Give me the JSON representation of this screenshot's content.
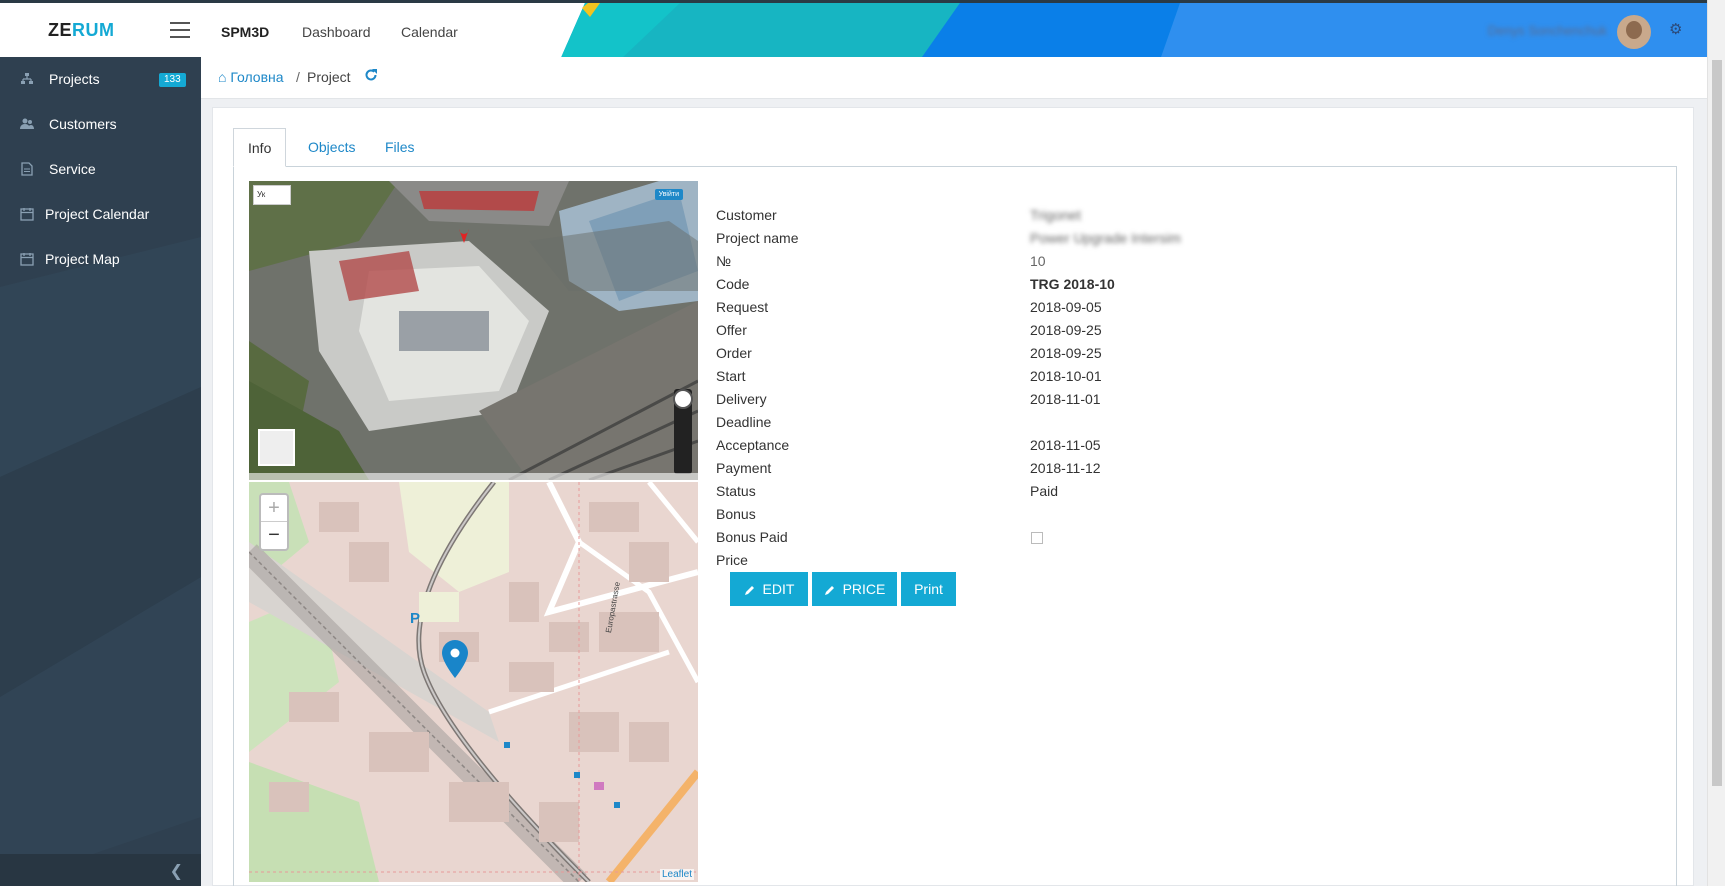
{
  "header": {
    "logo_a": "ZE",
    "logo_b": "RUM",
    "brand": "SPM3D",
    "nav": [
      "Dashboard",
      "Calendar"
    ],
    "user_name": "Denys Sonchenchuk"
  },
  "sidebar": {
    "items": [
      {
        "label": "Projects",
        "icon": "sitemap-icon",
        "badge": "133"
      },
      {
        "label": "Customers",
        "icon": "users-icon"
      },
      {
        "label": "Service",
        "icon": "file-icon"
      },
      {
        "label": "Project Calendar",
        "icon": "calendar-icon"
      },
      {
        "label": "Project Map",
        "icon": "calendar-icon"
      }
    ]
  },
  "breadcrumb": {
    "home": "Головна",
    "separator": "/",
    "current": "Project"
  },
  "tabs": [
    "Info",
    "Objects",
    "Files"
  ],
  "maps": {
    "streetview_lang": "Ук",
    "streetview_exit": "Увійти",
    "leaflet_attribution": "Leaflet",
    "parking_label": "P",
    "street_label": "Europastrasse"
  },
  "info": {
    "customer": {
      "label": "Customer",
      "value": "Trigonet"
    },
    "project_name": {
      "label": "Project name",
      "value": "Power Upgrade Intersim"
    },
    "number": {
      "label": "№",
      "value": "10"
    },
    "code": {
      "label": "Code",
      "value": "TRG 2018-10"
    },
    "request": {
      "label": "Request",
      "value": "2018-09-05"
    },
    "offer": {
      "label": "Offer",
      "value": "2018-09-25"
    },
    "order": {
      "label": "Order",
      "value": "2018-09-25"
    },
    "start": {
      "label": "Start",
      "value": "2018-10-01"
    },
    "delivery": {
      "label": "Delivery",
      "value": "2018-11-01"
    },
    "deadline": {
      "label": "Deadline",
      "value": ""
    },
    "acceptance": {
      "label": "Acceptance",
      "value": "2018-11-05"
    },
    "payment": {
      "label": "Payment",
      "value": "2018-11-12"
    },
    "status": {
      "label": "Status",
      "value": "Paid"
    },
    "bonus": {
      "label": "Bonus",
      "value": ""
    },
    "bonus_paid": {
      "label": "Bonus Paid",
      "checked": false
    },
    "price": {
      "label": "Price",
      "value": ""
    }
  },
  "actions": {
    "edit": "EDIT",
    "price": "PRICE",
    "print": "Print"
  },
  "colors": {
    "accent": "#14a9d4",
    "sidebar": "#2f4050",
    "link": "#1e88c8"
  }
}
